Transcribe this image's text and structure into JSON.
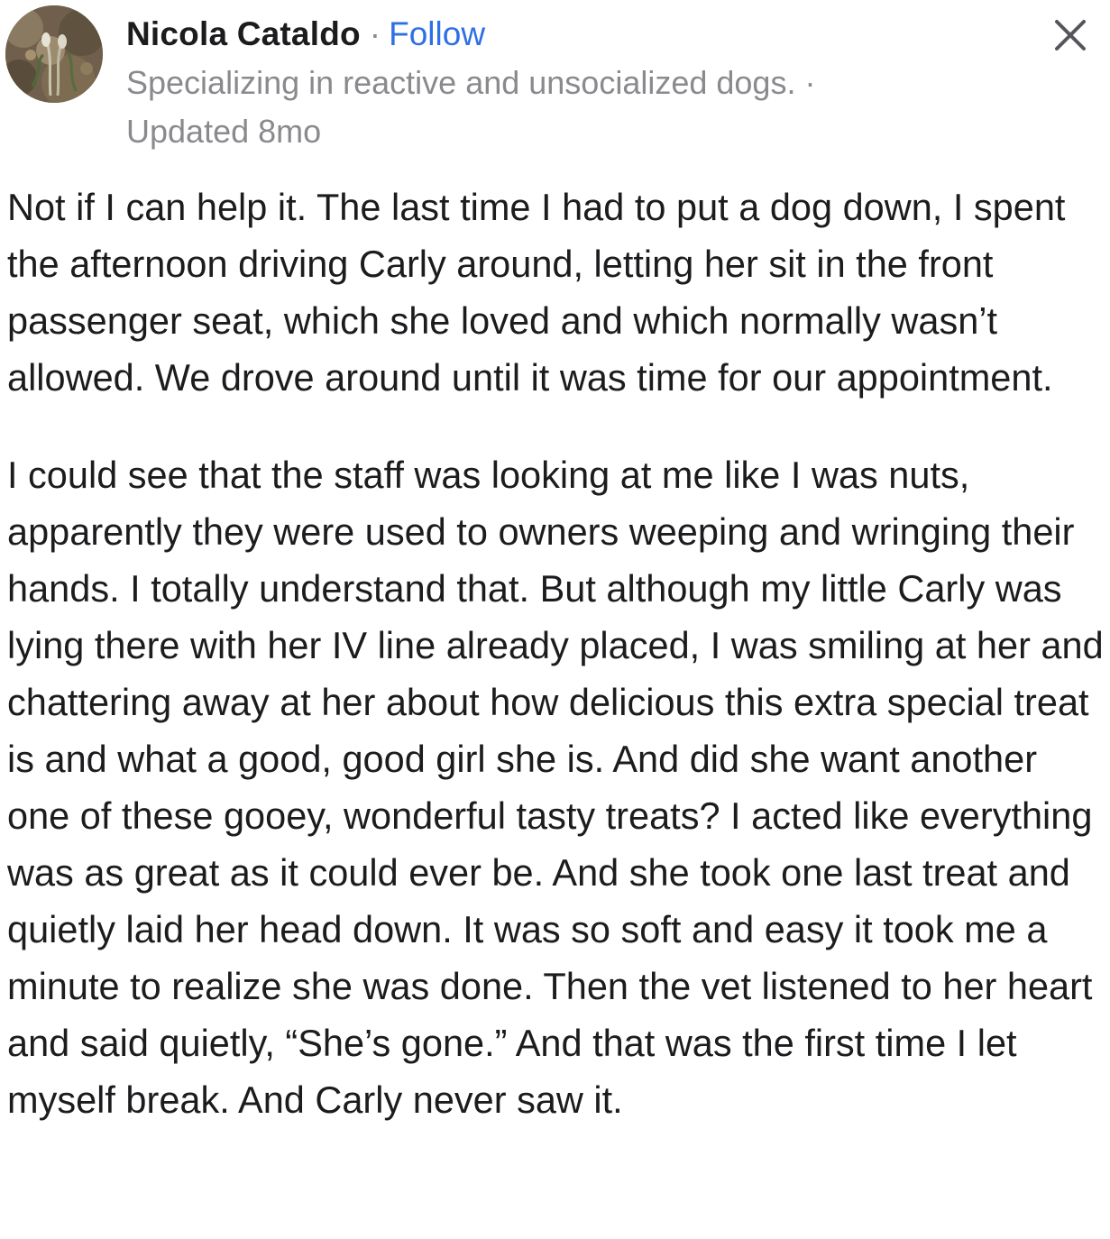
{
  "post": {
    "author": {
      "name": "Nicola Cataldo",
      "separator": "·",
      "follow_label": "Follow",
      "credential": "Specializing in reactive and unsocialized dogs. ·",
      "updated": "Updated 8mo",
      "avatar_icon": "profile-photo-plant-icon"
    },
    "close_icon": "close-x-icon",
    "paragraphs": [
      "Not if I can help it. The last time I had to put a dog down, I spent the afternoon driving Carly around, letting her sit in the front passenger seat, which she loved and which normally wasn’t allowed. We drove around until it was time for our appointment.",
      "I could see that the staff was looking at me like I was nuts, apparently they were used to owners weeping and wringing their hands. I totally understand that. But although my little Carly was lying there with her IV line already placed, I was smiling at her and chattering away at her about how delicious this extra special treat is and what a good, good girl she is. And did she want another one of these gooey, wonderful tasty treats? I acted like everything was as great as it could ever be. And she took one last treat and quietly laid her head down. It was so soft and easy it took me a minute to realize she was done. Then the vet listened to her heart and said quietly, “She’s gone.” And that was the first time I let myself break. And Carly never saw it."
    ]
  },
  "colors": {
    "text": "#1c1c1e",
    "secondary_text": "#8a8a8e",
    "link": "#2f6fe4",
    "background": "#ffffff"
  }
}
